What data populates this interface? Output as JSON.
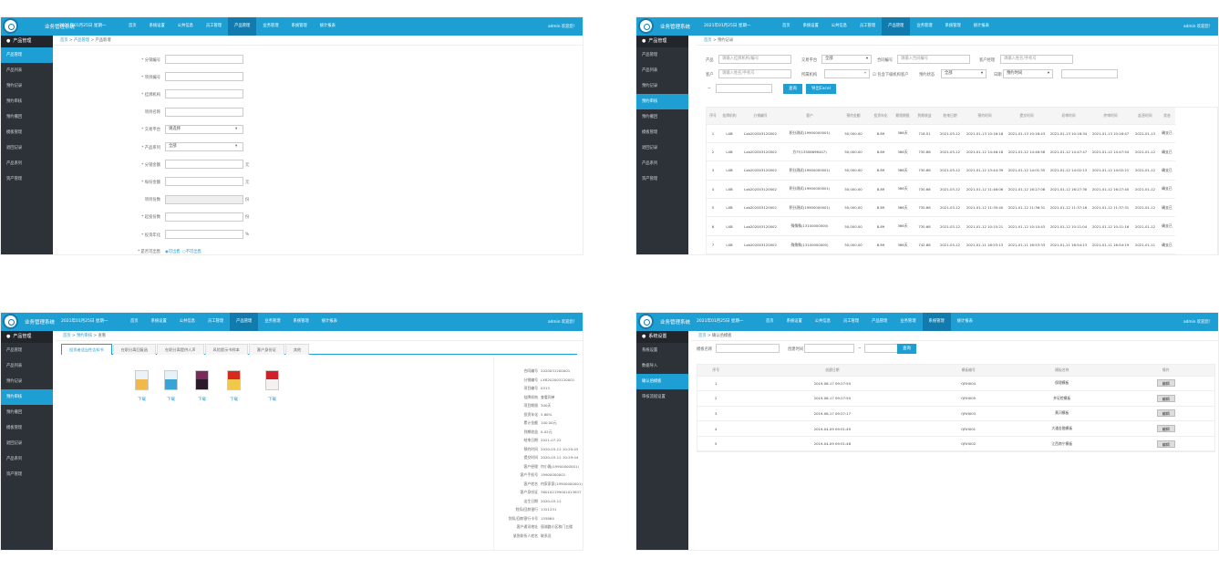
{
  "header": {
    "system_name": "业务管理系统",
    "date": "2021年01月25日 星期一",
    "user": "admin 欢迎您！",
    "tabs": [
      "首页",
      "系统设置",
      "公共信息",
      "员工管理",
      "产品管理",
      "业务管理",
      "系统管理",
      "统计报表"
    ]
  },
  "sidebar_product": {
    "title": "产品管理",
    "items": [
      "产品管理",
      "产品列表",
      "预约记录",
      "预约审核",
      "预约撤回",
      "模板管理",
      "退回记录",
      "产品系列",
      "资产管理"
    ]
  },
  "sidebar_system": {
    "title": "系统设置",
    "items": [
      "系统设置",
      "数据导入",
      "确认函模板",
      "审核流程设置"
    ]
  },
  "panel1": {
    "breadcrumb": [
      "首页",
      "产品管理",
      "产品新增"
    ],
    "fields": [
      {
        "label": "* 分销编号",
        "value": "",
        "unit": ""
      },
      {
        "label": "* 项目编号",
        "value": "",
        "unit": ""
      },
      {
        "label": "* 挂牌机构",
        "value": "",
        "unit": ""
      },
      {
        "label": "项目名称",
        "value": "",
        "unit": ""
      },
      {
        "label": "* 交易平台",
        "value": "请选择",
        "unit": ""
      },
      {
        "label": "* 产品系列",
        "value": "全部",
        "unit": ""
      },
      {
        "label": "* 分销金额",
        "value": "",
        "unit": "元"
      },
      {
        "label": "* 每份金额",
        "value": "",
        "unit": "元"
      },
      {
        "label": "项目份数",
        "value": "",
        "unit": "份"
      },
      {
        "label": "* 起投份数",
        "value": "",
        "unit": "份"
      },
      {
        "label": "* 投资年化",
        "value": "",
        "unit": "%"
      }
    ],
    "sale_label": "* 是否可出售",
    "sale_options": [
      "可出售",
      "不可出售"
    ]
  },
  "panel2": {
    "breadcrumb": [
      "首页",
      "预约记录"
    ],
    "filters": {
      "product_label": "产品",
      "product_ph": "请输入挂牌机构/编号",
      "platform_label": "交易平台",
      "platform_value": "全部",
      "contract_label": "合同编号",
      "contract_ph": "请输入合同编号",
      "manager_label": "客户经理",
      "manager_ph": "请输入姓名/手机号",
      "customer_label": "客户",
      "customer_ph": "请输入姓名/手机号",
      "org_label": "所属机构",
      "include_label": "包含下级机构客户",
      "status_label": "预约状态",
      "status_value": "全部",
      "date_label": "日期",
      "date_value": "预约时间",
      "range_sep": "~",
      "query": "查询",
      "export": "导出Excel"
    },
    "columns": [
      "序号",
      "挂牌机构",
      "分销编号",
      "客户",
      "预约金额",
      "投资年化",
      "期限期限",
      "到期收益",
      "结束日期",
      "预约时间",
      "提交时间",
      "初审时间",
      "终审时间",
      "起息时间",
      "状态"
    ],
    "rows": [
      [
        "1",
        "LXB",
        "Lxb202003120002",
        "积分测试(19900000001)",
        "50,000.00",
        "8.89",
        "366天",
        "716.51",
        "2021-03-12",
        "2021-01-13 10:16:18",
        "2021-01-13 10:16:43",
        "2021-01-13 10:16:34",
        "2021-01-13 10:16:47",
        "2021-01-13",
        "确支已"
      ],
      [
        "2",
        "LXB",
        "Lxb202003120002",
        "方??(13508696447)",
        "50,000.00",
        "8.89",
        "366天",
        "730.68",
        "2021-03-12",
        "2021-01-12 14:46:18",
        "2021-01-12 14:46:56",
        "2021-01-12 14:47:47",
        "2021-01-12 14:47:54",
        "2021-01-12",
        "确支已"
      ],
      [
        "3",
        "LXB",
        "Lxb202003120002",
        "积分测试(19900000001)",
        "50,000.00",
        "8.89",
        "366天",
        "730.68",
        "2021-03-12",
        "2021-01-12 13:44:39",
        "2021-01-12 14:01:35",
        "2021-01-12 14:02:13",
        "2021-01-12 14:02:21",
        "2021-01-12",
        "确支已"
      ],
      [
        "4",
        "LXB",
        "Lxb202003120002",
        "积分测试(19900000001)",
        "50,000.00",
        "8.89",
        "366天",
        "730.68",
        "2021-03-12",
        "2021-01-12 11:46:06",
        "2021-01-12 16:27:08",
        "2021-01-12 16:27:30",
        "2021-01-12 16:27:40",
        "2021-01-12",
        "确支已"
      ],
      [
        "5",
        "LXB",
        "Lxb202003120002",
        "积分测试(19900000001)",
        "50,000.00",
        "8.89",
        "366天",
        "730.68",
        "2021-03-12",
        "2021-01-12 11:35:40",
        "2021-01-12 11:36:31",
        "2021-01-12 11:37:16",
        "2021-01-12 11:37:31",
        "2021-01-12",
        "确支已"
      ],
      [
        "6",
        "LXB",
        "Lxb202003120002",
        "殊殊殊(13100000000)",
        "50,000.00",
        "8.89",
        "366天",
        "730.68",
        "2021-03-12",
        "2021-01-12 10:10:21",
        "2021-01-12 10:10:43",
        "2021-01-12 10:11:04",
        "2021-01-12 10:11:16",
        "2021-01-12",
        "确支已"
      ],
      [
        "7",
        "LXB",
        "Lxb202003120002",
        "殊殊殊(13100000000)",
        "50,000.00",
        "8.89",
        "366天",
        "742.88",
        "2021-03-12",
        "2021-01-11 16:53:13",
        "2021-01-11 16:53:33",
        "2021-01-11 16:54:13",
        "2021-01-11 16:54:19",
        "2021-01-11",
        "确支已"
      ]
    ]
  },
  "panel3": {
    "breadcrumb": [
      "首页",
      "预约审核",
      "查看"
    ],
    "tabs": [
      "投资者适当性告知书",
      "在职分离回复函",
      "在职分离提供人声",
      "风险提示书样本",
      "客户身份证",
      "其他"
    ],
    "download": "下载",
    "kv": [
      [
        "合同编号",
        "2020031200001"
      ],
      [
        "分销编号",
        "LXB202003120001"
      ],
      [
        "项目编号",
        "0313"
      ],
      [
        "挂牌机构",
        "查看同单"
      ],
      [
        "项目期限",
        "300天"
      ],
      [
        "投资年化",
        "5.86%"
      ],
      [
        "累计金额",
        "100.00元"
      ],
      [
        "到期收益",
        "0.02元"
      ],
      [
        "结束日期",
        "2021-07-22"
      ],
      [
        "预约时间",
        "2020-03-12 10:20:45"
      ],
      [
        "提交时间",
        "2020-03-12 10:29:44"
      ],
      [
        "客户经理",
        "何小磊(19900000001)"
      ],
      [
        "客户手机号",
        "19900000001"
      ],
      [
        "客户姓名",
        "何家家家(19900000001)"
      ],
      [
        "客户身份证",
        "360102199001013637"
      ],
      [
        "出生日期",
        "2020-03-12"
      ],
      [
        "划扣/回款银行",
        "1321231"
      ],
      [
        "划扣/回款银行卡号",
        "155864"
      ],
      [
        "客户通讯地址",
        "丽湖路小区和门五楼"
      ],
      [
        "紧急联系人姓名",
        "联系员"
      ]
    ]
  },
  "panel4": {
    "breadcrumb": [
      "首页",
      "确认函模板"
    ],
    "name_label": "模板名称",
    "time_label": "创建时间",
    "range_sep": "~",
    "query": "查询",
    "columns": [
      "序号",
      "创建日期",
      "模板编号",
      "模板名称",
      "操作"
    ],
    "rows": [
      [
        "1",
        "2019-06-17 09:27:50",
        "QRH004",
        "保理模板"
      ],
      [
        "2",
        "2019-06-17 09:27:50",
        "QRH005",
        "并证检模板"
      ],
      [
        "3",
        "2019-06-17 09:27:17",
        "QRH003",
        "黄河模板"
      ],
      [
        "4",
        "2019-04-09 09:51:49",
        "QRH001",
        "大通金融模板"
      ],
      [
        "5",
        "2019-04-09 09:51:46",
        "QRH002",
        "江西南宁模板"
      ]
    ],
    "edit_label": "编辑"
  }
}
